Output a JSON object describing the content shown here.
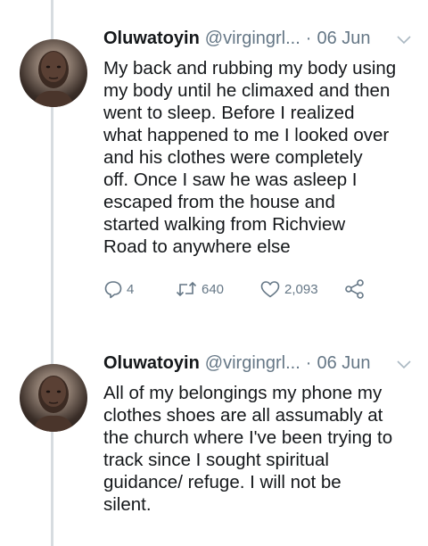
{
  "tweets": [
    {
      "author_name": "Oluwatoyin",
      "handle": "@virgingrl...",
      "separator": "·",
      "date": "06 Jun",
      "lines": [
        "My back and rubbing my body using",
        "my body until he climaxed and then",
        "went to sleep. Before I realized",
        "what happened to me I looked over",
        "and his clothes were completely",
        "off. Once I saw he was asleep I",
        "escaped from the house and",
        "started walking from Richview",
        "Road to anywhere else"
      ],
      "replies": "4",
      "retweets": "640",
      "likes": "2,093"
    },
    {
      "author_name": "Oluwatoyin",
      "handle": "@virgingrl...",
      "separator": "·",
      "date": "06 Jun",
      "lines": [
        "All of my belongings my phone my",
        "clothes shoes are all assumably at",
        "the church where I've been trying to",
        "track since I sought spiritual",
        "guidance/ refuge. I will not be",
        "silent."
      ]
    }
  ],
  "icons": {
    "reply": "reply-icon",
    "retweet": "retweet-icon",
    "like": "like-icon",
    "share": "share-icon",
    "more": "chevron-down-icon"
  },
  "colors": {
    "text": "#14171a",
    "muted": "#657786",
    "thread_line": "#d7dce0"
  }
}
